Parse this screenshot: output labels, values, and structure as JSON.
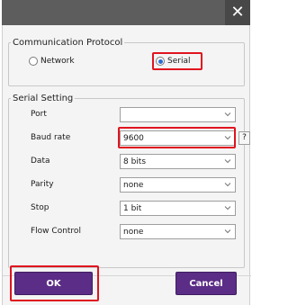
{
  "titlebar": {
    "close_icon": "close-icon"
  },
  "protocol_group": {
    "legend": "Communication Protocol",
    "options": [
      {
        "label": "Network",
        "selected": false
      },
      {
        "label": "Serial",
        "selected": true
      }
    ]
  },
  "serial_group": {
    "legend": "Serial Setting",
    "fields": [
      {
        "label": "Port",
        "value": ""
      },
      {
        "label": "Baud rate",
        "value": "9600"
      },
      {
        "label": "Data",
        "value": "8 bits"
      },
      {
        "label": "Parity",
        "value": "none"
      },
      {
        "label": "Stop",
        "value": "1 bit"
      },
      {
        "label": "Flow Control",
        "value": "none"
      }
    ],
    "help_label": "?"
  },
  "buttons": {
    "ok_label": "OK",
    "cancel_label": "Cancel"
  },
  "colors": {
    "titlebar": "#5d5d5d",
    "accent": "#5b2d86",
    "highlight": "#e0141e",
    "radio_selected": "#2b6cd6"
  }
}
